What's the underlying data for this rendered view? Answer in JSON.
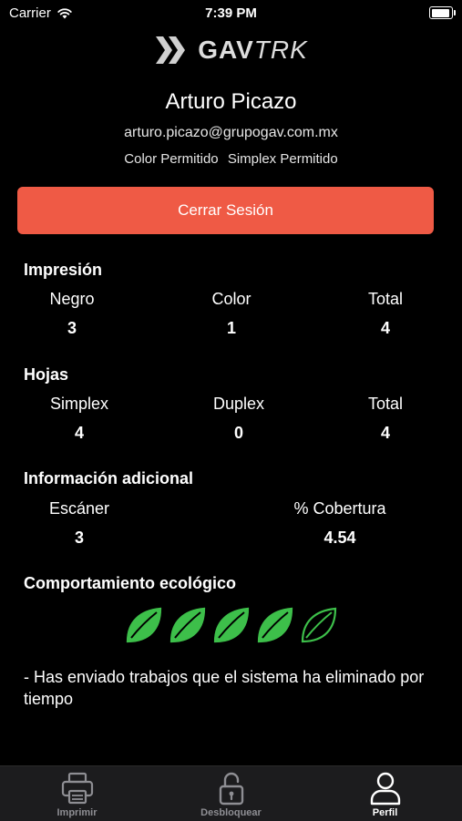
{
  "status_bar": {
    "carrier": "Carrier",
    "time": "7:39 PM",
    "battery_level": 1.0
  },
  "logo": {
    "bold": "GAV",
    "italic": "TRK"
  },
  "user": {
    "name": "Arturo Picazo",
    "email": "arturo.picazo@grupogav.com.mx",
    "permissions": [
      "Color Permitido",
      "Simplex Permitido"
    ]
  },
  "logout_label": "Cerrar Sesión",
  "impresion": {
    "title": "Impresión",
    "negro_label": "Negro",
    "negro_value": "3",
    "color_label": "Color",
    "color_value": "1",
    "total_label": "Total",
    "total_value": "4"
  },
  "hojas": {
    "title": "Hojas",
    "simplex_label": "Simplex",
    "simplex_value": "4",
    "duplex_label": "Duplex",
    "duplex_value": "0",
    "total_label": "Total",
    "total_value": "4"
  },
  "info": {
    "title": "Información adicional",
    "escaner_label": "Escáner",
    "escaner_value": "3",
    "cobertura_label": "% Cobertura",
    "cobertura_value": "4.54"
  },
  "eco": {
    "title": "Comportamiento ecológico",
    "rating": 4,
    "max": 5,
    "leaf_color": "#3dbf4a",
    "message": "- Has enviado trabajos que el sistema ha eliminado por tiempo"
  },
  "tabs": [
    {
      "label": "Imprimir",
      "icon": "printer-icon",
      "active": false
    },
    {
      "label": "Desbloquear",
      "icon": "unlock-icon",
      "active": false
    },
    {
      "label": "Perfil",
      "icon": "person-icon",
      "active": true
    }
  ]
}
